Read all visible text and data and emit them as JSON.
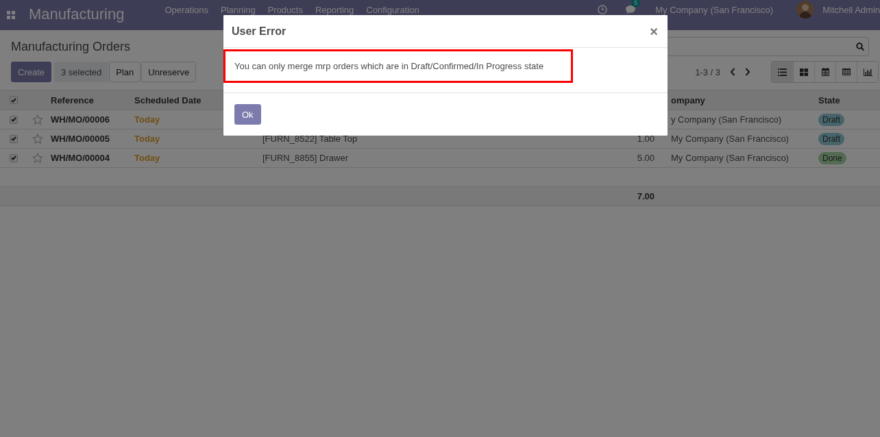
{
  "navbar": {
    "app_name": "Manufacturing",
    "menu": [
      "Operations",
      "Planning",
      "Products",
      "Reporting",
      "Configuration"
    ],
    "messages_badge": "5",
    "company": "My Company (San Francisco)",
    "user": "Mitchell Admin"
  },
  "control_panel": {
    "breadcrumb": "Manufacturing Orders",
    "buttons": [
      {
        "label": "Create",
        "kind": "primary"
      },
      {
        "label": "3 selected",
        "kind": "info"
      },
      {
        "label": "Plan",
        "kind": "plain"
      },
      {
        "label": "Unreserve",
        "kind": "plain"
      }
    ],
    "pager": "1-3 / 3",
    "views": [
      {
        "kind": "list",
        "selected": true
      },
      {
        "kind": "kanban",
        "selected": false
      },
      {
        "kind": "calendar",
        "selected": false
      },
      {
        "kind": "pivot",
        "selected": false
      },
      {
        "kind": "graph",
        "selected": false
      }
    ]
  },
  "table": {
    "header_checked": true,
    "columns": [
      "Reference",
      "Scheduled Date",
      "ompany",
      "State"
    ],
    "rows": [
      {
        "selected": true,
        "starred": false,
        "reference": "WH/MO/00006",
        "scheduled_date": "Today",
        "company": "y Company (San Francisco)",
        "state": {
          "label": "Draft",
          "kind": "draft"
        }
      },
      {
        "selected": true,
        "starred": false,
        "reference": "WH/MO/00005",
        "scheduled_date": "Today",
        "product": "[FURN_8522] Table Top",
        "quantity": "1.00",
        "company": "My Company (San Francisco)",
        "state": {
          "label": "Draft",
          "kind": "draft"
        }
      },
      {
        "selected": true,
        "starred": false,
        "reference": "WH/MO/00004",
        "scheduled_date": "Today",
        "product": "[FURN_8855] Drawer",
        "quantity": "5.00",
        "company": "My Company (San Francisco)",
        "state": {
          "label": "Done",
          "kind": "done"
        }
      }
    ],
    "total": "7.00"
  },
  "dialog": {
    "title": "User Error",
    "close": "×",
    "message": "You can only merge mrp orders which are in Draft/Confirmed/In Progress state",
    "buttons": [
      "Ok"
    ]
  }
}
